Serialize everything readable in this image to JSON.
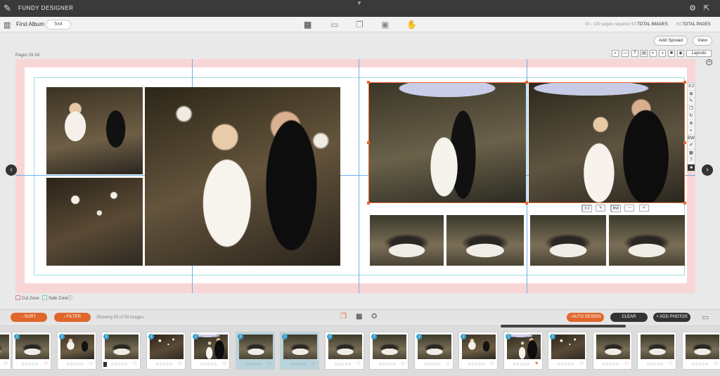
{
  "app": {
    "name": "FUNDY DESIGNER"
  },
  "toolbar": {
    "album_name": "First Album",
    "album_size": "5x4",
    "pages_required": "30 - 100 pages required",
    "total_images_count": "93",
    "total_images_label": "TOTAL IMAGES",
    "total_pages_count": "63",
    "total_pages_label": "TOTAL PAGES",
    "add_spread": "Add Spread",
    "view": "View"
  },
  "canvas": {
    "pages_label": "Pages 33-34",
    "layouts_label": "Layouts",
    "ratio_label": "3:2",
    "bw_label": "BW"
  },
  "zones": {
    "cut_zone": "Cut Zone",
    "safe_zone": "Safe Zone"
  },
  "bottombar": {
    "sort": "SORT",
    "filter": "FILTER",
    "showing": "Showing 93 of 93 images",
    "auto_design": "AUTO DESIGN",
    "clear": "CLEAR",
    "add_photos": "+ ADD PHOTOS"
  },
  "thumbnails": [
    {
      "badge": "",
      "stars": "☆☆☆☆☆",
      "heart": "♡"
    },
    {
      "badge": "1",
      "stars": "☆☆☆☆☆",
      "heart": "♡"
    },
    {
      "badge": "1",
      "stars": "☆☆☆☆☆",
      "heart": "♡"
    },
    {
      "badge": "1",
      "stars": "☆☆☆☆☆",
      "heart": "♡"
    },
    {
      "badge": "1",
      "stars": "☆☆☆☆☆",
      "heart": "♡"
    },
    {
      "badge": "1",
      "stars": "☆☆☆☆☆",
      "heart": "♡"
    },
    {
      "badge": "1",
      "stars": "☆☆☆☆☆",
      "heart": "♡"
    },
    {
      "badge": "1",
      "stars": "☆☆☆☆☆",
      "heart": "♡"
    },
    {
      "badge": "1",
      "stars": "☆☆☆☆☆",
      "heart": "♡"
    },
    {
      "badge": "1",
      "stars": "☆☆☆☆☆",
      "heart": "♡"
    },
    {
      "badge": "1",
      "stars": "☆☆☆☆☆",
      "heart": "♡"
    },
    {
      "badge": "1",
      "stars": "☆☆☆☆☆",
      "heart": "♡"
    },
    {
      "badge": "1",
      "stars": "☆☆☆☆☆",
      "heart": "♥"
    },
    {
      "badge": "1",
      "stars": "☆☆☆☆☆",
      "heart": "♡"
    },
    {
      "badge": "",
      "stars": "☆☆☆☆☆",
      "heart": "♡"
    },
    {
      "badge": "",
      "stars": "☆☆☆☆☆",
      "heart": "♡"
    },
    {
      "badge": "",
      "stars": "☆☆☆☆☆",
      "heart": "♡"
    }
  ],
  "colors": {
    "accent": "#e0662c",
    "guide": "#6ab0e8",
    "cut_zone": "#f9d6d6"
  }
}
